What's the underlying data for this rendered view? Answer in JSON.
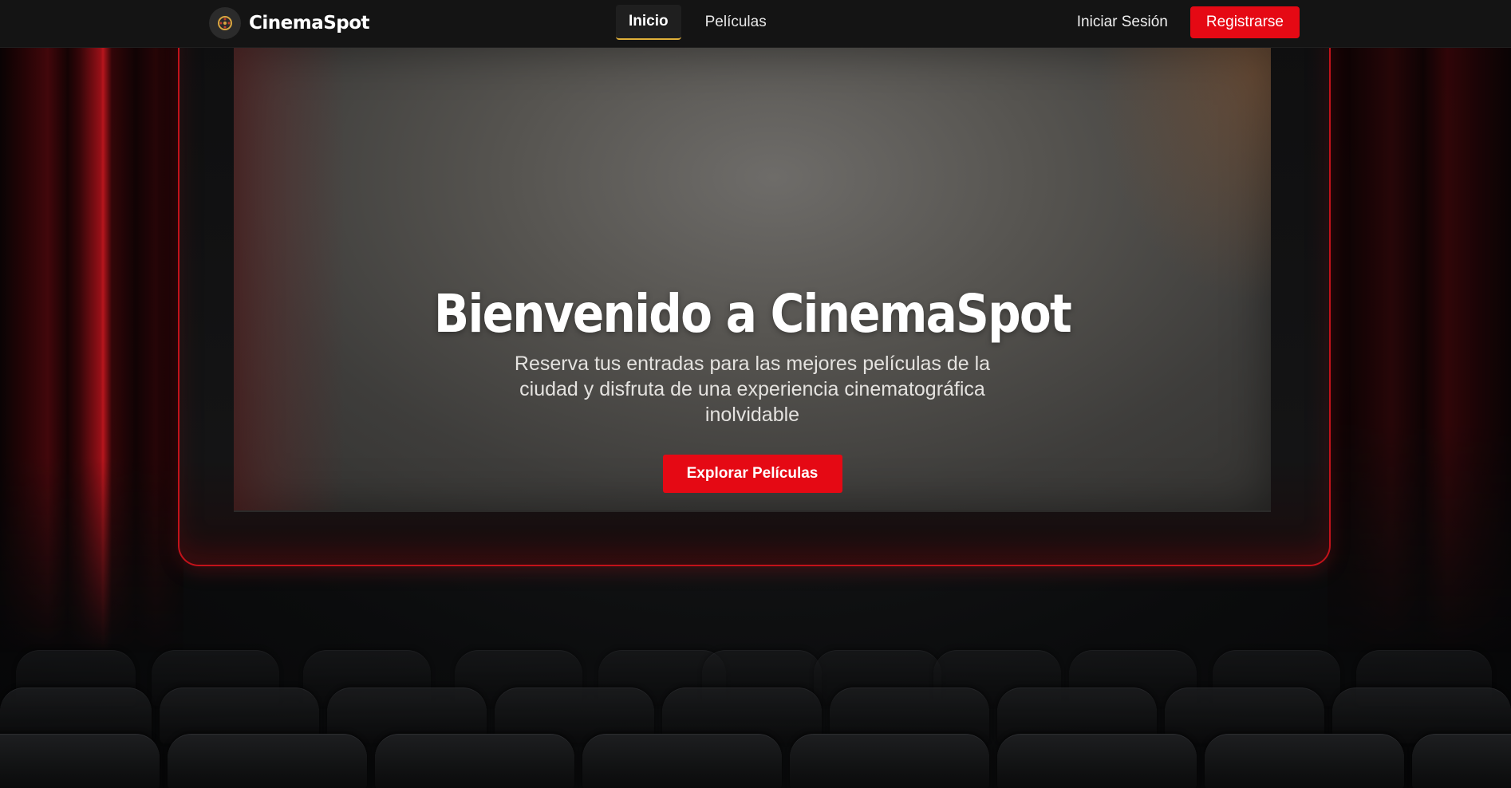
{
  "nav": {
    "brand": "CinemaSpot",
    "links": [
      {
        "label": "Inicio",
        "active": true
      },
      {
        "label": "Películas",
        "active": false
      }
    ],
    "login_label": "Iniciar Sesión",
    "register_label": "Registrarse"
  },
  "hero": {
    "title": "Bienvenido a CinemaSpot",
    "subtitle": "Reserva tus entradas para las mejores películas de la ciudad y disfruta de una experiencia cinematográfica inolvidable",
    "cta_label": "Explorar Películas"
  },
  "colors": {
    "accent": "#e50914",
    "nav_bg": "#141414",
    "active_underline": "#e0b03a",
    "frame_red": "#c2121a"
  },
  "icons": {
    "brand_logo": "film-reel-icon"
  }
}
